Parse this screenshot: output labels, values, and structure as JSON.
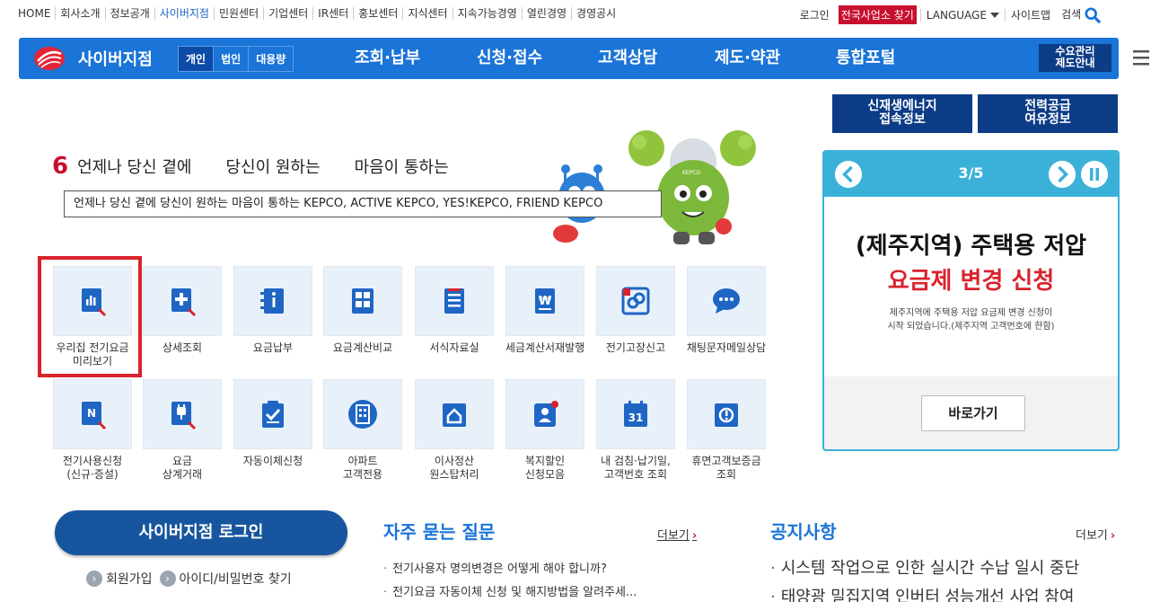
{
  "topbar": {
    "links": [
      "HOME",
      "회사소개",
      "정보공개",
      "사이버지점",
      "민원센터",
      "기업센터",
      "IR센터",
      "홍보센터",
      "지식센터",
      "지속가능경영",
      "열린경영",
      "경영공시"
    ],
    "login": "로그인",
    "branch_find": "전국사업소 찾기",
    "language": "LANGUAGE",
    "sitemap": "사이트맵",
    "search": "검색"
  },
  "nav": {
    "brand": "사이버지점",
    "segments": [
      "개인",
      "법인",
      "대용량"
    ],
    "menus": [
      "조회·납부",
      "신청·접수",
      "고객상담",
      "제도·약관",
      "통합포털"
    ],
    "guide_line1": "수요관리",
    "guide_line2": "제도안내"
  },
  "side_buttons": {
    "renewable": [
      "신재생에너지",
      "접속정보"
    ],
    "supply": [
      "전력공급",
      "여유정보"
    ]
  },
  "slogan": {
    "words": [
      "언제나 당신 곁에",
      "당신이 원하는",
      "마음이 통하는"
    ],
    "tooltip": "언제나 당신 곁에 당신이 원하는 마음이 통하는 KEPCO, ACTIVE KEPCO, YES!KEPCO, FRIEND KEPCO",
    "mascot_label": "KEPCO"
  },
  "quick_menu": [
    {
      "label": "우리집 전기요금\n미리보기",
      "icon": "bar-chart-book-icon"
    },
    {
      "label": "상세조회",
      "icon": "plus-book-icon"
    },
    {
      "label": "요금납부",
      "icon": "info-notebook-icon"
    },
    {
      "label": "요금계산비교",
      "icon": "calculator-icon"
    },
    {
      "label": "서식자료실",
      "icon": "document-list-icon"
    },
    {
      "label": "세금계산서재발행",
      "icon": "won-invoice-icon"
    },
    {
      "label": "전기고장신고",
      "icon": "broken-link-icon"
    },
    {
      "label": "채팅문자메일상담",
      "icon": "chat-bubble-icon"
    },
    {
      "label": "전기사용신청\n(신규·증설)",
      "icon": "new-book-icon"
    },
    {
      "label": "요금\n상계거래",
      "icon": "plug-book-icon"
    },
    {
      "label": "자동이체신청",
      "icon": "check-clipboard-icon"
    },
    {
      "label": "아파트\n고객전용",
      "icon": "apartment-icon"
    },
    {
      "label": "이사정산\n원스탑처리",
      "icon": "house-folder-icon"
    },
    {
      "label": "복지할인\n신청모음",
      "icon": "person-card-icon"
    },
    {
      "label": "내 검침·납기일,\n고객번호 조회",
      "icon": "calendar-31-icon"
    },
    {
      "label": "휴면고객보증금\n조회",
      "icon": "alert-folder-icon"
    }
  ],
  "calendar_day": "31",
  "banner": {
    "page": "3/5",
    "title1": "(제주지역) 주택용 저압",
    "title2": "요금제 변경 신청",
    "desc1": "제주지역에 주택용 저압 요금제 변경 신청이",
    "desc2": "시작 되었습니다.(제주지역 고객번호에 한함)",
    "button": "바로가기"
  },
  "login": {
    "button": "사이버지점 로그인",
    "signup": "회원가입",
    "find": "아이디/비밀번호 찾기"
  },
  "faq": {
    "title": "자주 묻는 질문",
    "more": "더보기",
    "items": [
      "전기사용자 명의변경은 어떻게 해야 합니까?",
      "전기요금 자동이체 신청 및 해지방법을 알려주세..."
    ]
  },
  "notice": {
    "title": "공지사항",
    "more": "더보기",
    "items": [
      "시스템 작업으로 인한 실시간 수납 일시 중단",
      "태양광 밀집지역 인버터 성능개선 사업 참여"
    ]
  },
  "colors": {
    "nav_blue": "#1b74d7",
    "dark_blue": "#0d3c86",
    "accent_red": "#d9232d",
    "banner_cyan": "#3bb1d9"
  }
}
